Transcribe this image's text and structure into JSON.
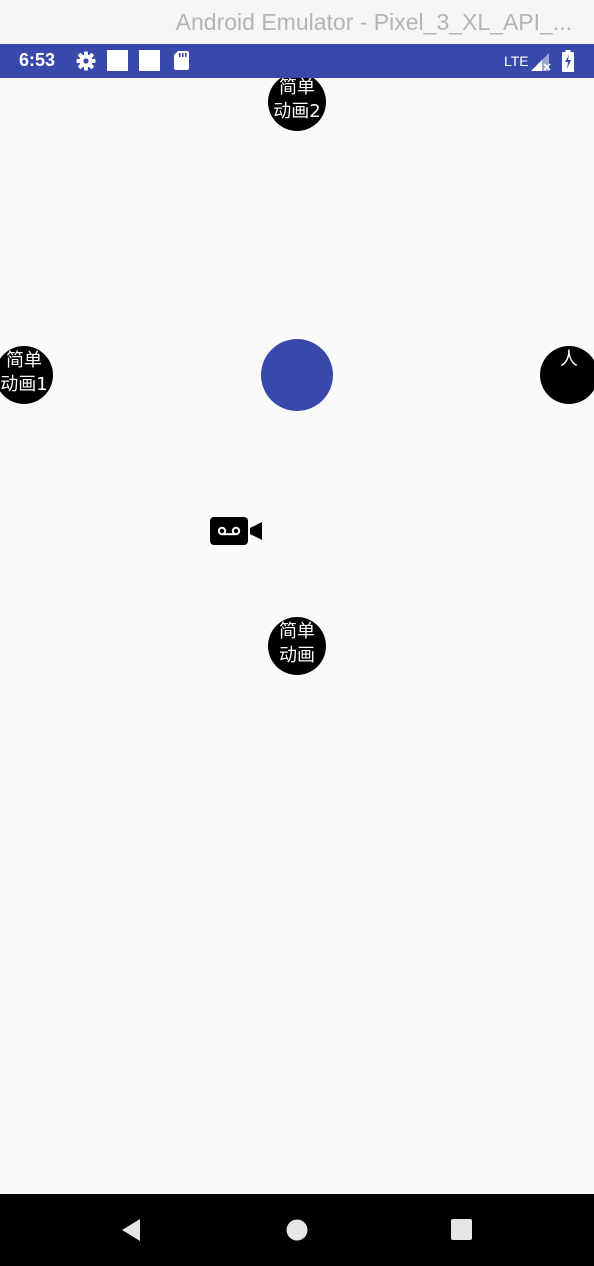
{
  "window": {
    "title": "Android Emulator - Pixel_3_XL_API_..."
  },
  "status_bar": {
    "time": "6:53",
    "icons": [
      "gear-icon",
      "notification-square-icon",
      "notification-square-icon",
      "sd-card-icon",
      "signal-icon",
      "battery-icon"
    ],
    "network": "LTE",
    "background_color": "#3949ab"
  },
  "menu": {
    "top": {
      "line1": "简单",
      "line2": "动画2"
    },
    "left": {
      "line1": "简单",
      "line2": "动画1"
    },
    "right": {
      "line1": "人"
    },
    "bottom": {
      "line1": "简单",
      "line2": "动画"
    },
    "center_button_color": "#3949ab"
  },
  "navigation_bar": {
    "buttons": [
      "back-icon",
      "home-icon",
      "recents-icon"
    ]
  }
}
